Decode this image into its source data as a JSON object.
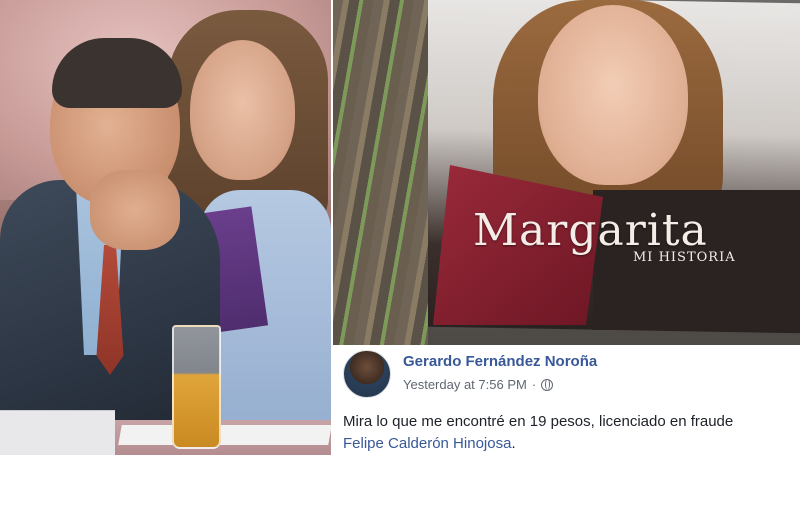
{
  "cover": {
    "title": "Margarita",
    "subtitle": "MI HISTORIA"
  },
  "post": {
    "author": "Gerardo Fernández Noroña",
    "timestamp": "Yesterday at 7:56 PM",
    "separator": "·",
    "privacy_icon": "globe-icon",
    "text": "Mira lo que me encontré en 19 pesos, licenciado en fraude",
    "mention": "Felipe Calderón Hinojosa",
    "mention_suffix": "."
  },
  "colors": {
    "link": "#385898",
    "meta": "#606770",
    "text": "#1d2129"
  }
}
